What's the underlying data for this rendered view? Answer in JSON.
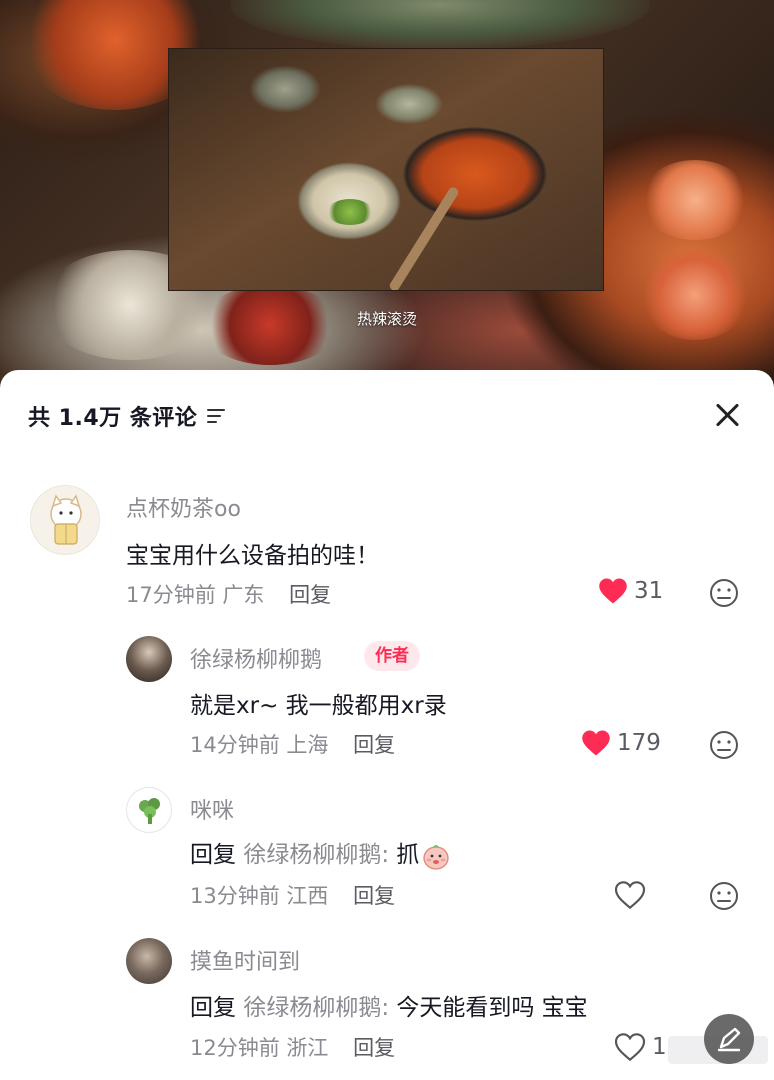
{
  "video": {
    "caption": "热辣滚烫"
  },
  "comments_panel": {
    "title": "共 1.4万 条评论"
  },
  "comments": [
    {
      "username": "点杯奶茶oo",
      "text": "宝宝用什么设备拍的哇！",
      "time": "17分钟前",
      "location": "广东",
      "reply_label": "回复",
      "likes": "31",
      "liked": true
    },
    {
      "username": "徐绿杨柳柳鹅",
      "author_badge": "作者",
      "text": "就是xr~ 我一般都用xr录",
      "time": "14分钟前",
      "location": "上海",
      "reply_label": "回复",
      "likes": "179",
      "liked": true
    },
    {
      "username": "咪咪",
      "reply_prefix": "回复",
      "reply_to": "徐绿杨柳柳鹅:",
      "text": "抓",
      "emoji": "peach-face-emoji",
      "time": "13分钟前",
      "location": "江西",
      "reply_label": "回复",
      "liked": false
    },
    {
      "username": "摸鱼时间到",
      "reply_prefix": "回复",
      "reply_to": "徐绿杨柳柳鹅:",
      "text": "今天能看到吗 宝宝",
      "time": "12分钟前",
      "location": "浙江",
      "reply_label": "回复",
      "likes": "1",
      "liked": false
    }
  ],
  "colors": {
    "like_red": "#fe2c55",
    "text_primary": "#161823",
    "text_secondary": "#8a8b91"
  },
  "icons": [
    "sort-icon",
    "close-icon",
    "heart-icon",
    "heart-outline-icon",
    "dislike-face-icon"
  ]
}
